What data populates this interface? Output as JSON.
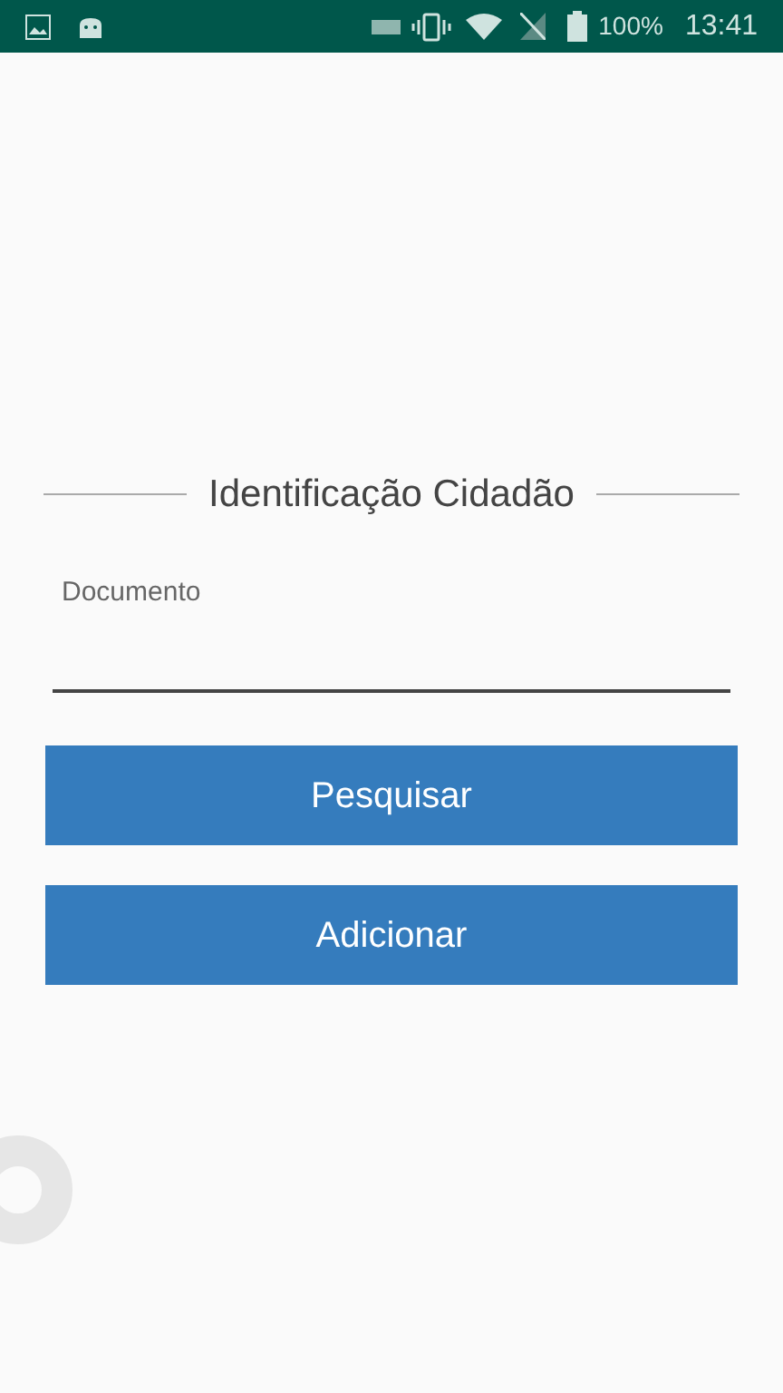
{
  "status_bar": {
    "battery": "100%",
    "time": "13:41"
  },
  "title": "Identificação Cidadão",
  "document_field": {
    "label": "Documento"
  },
  "buttons": [
    "Pesquisar",
    "Adicionar"
  ]
}
